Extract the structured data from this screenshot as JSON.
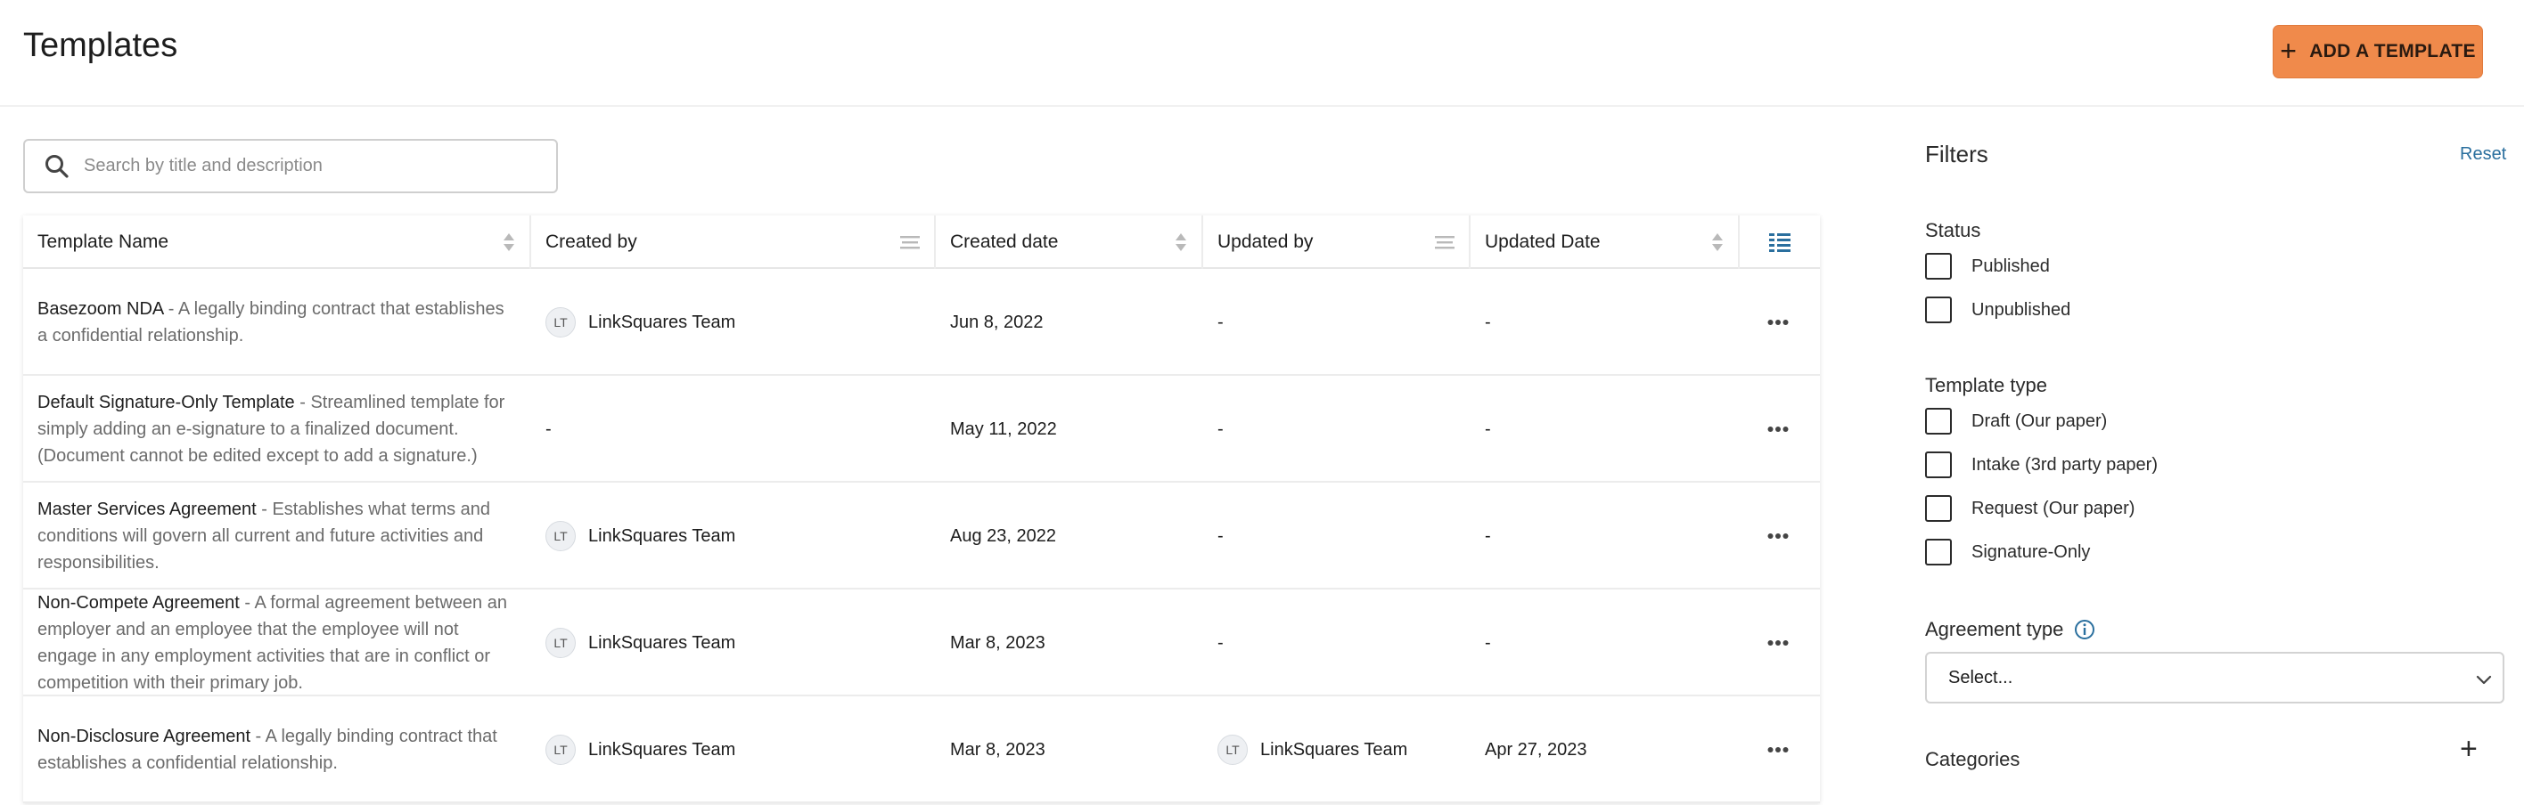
{
  "header": {
    "title": "Templates",
    "add_button_label": "ADD A TEMPLATE"
  },
  "search": {
    "placeholder": "Search by title and description",
    "value": ""
  },
  "table": {
    "columns": [
      "Template Name",
      "Created by",
      "Created date",
      "Updated by",
      "Updated Date"
    ],
    "rows": [
      {
        "name": "Basezoom NDA",
        "separator": " - ",
        "description": "A legally binding contract that establishes a confidential relationship.",
        "created_by_initials": "LT",
        "created_by": "LinkSquares Team",
        "created_date": "Jun 8, 2022",
        "updated_by_initials": "",
        "updated_by": "-",
        "updated_date": "-"
      },
      {
        "name": "Default Signature-Only Template",
        "separator": " - ",
        "description": "Streamlined template for simply adding an e-signature to a finalized document. (Document cannot be edited except to add a signature.)",
        "created_by_initials": "",
        "created_by": "-",
        "created_date": "May 11, 2022",
        "updated_by_initials": "",
        "updated_by": "-",
        "updated_date": "-"
      },
      {
        "name": "Master Services Agreement",
        "separator": " - ",
        "description": "Establishes what terms and conditions will govern all current and future activities and responsibilities.",
        "created_by_initials": "LT",
        "created_by": "LinkSquares Team",
        "created_date": "Aug 23, 2022",
        "updated_by_initials": "",
        "updated_by": "-",
        "updated_date": "-"
      },
      {
        "name": "Non-Compete Agreement",
        "separator": " - ",
        "description": "A formal agreement between an employer and an employee that the employee will not engage in any employment activities that are in conflict or competition with their primary job.",
        "created_by_initials": "LT",
        "created_by": "LinkSquares Team",
        "created_date": "Mar 8, 2023",
        "updated_by_initials": "",
        "updated_by": "-",
        "updated_date": "-"
      },
      {
        "name": "Non-Disclosure Agreement",
        "separator": " - ",
        "description": "A legally binding contract that establishes a confidential relationship.",
        "created_by_initials": "LT",
        "created_by": "LinkSquares Team",
        "created_date": "Mar 8, 2023",
        "updated_by_initials": "LT",
        "updated_by": "LinkSquares Team",
        "updated_date": "Apr 27, 2023"
      }
    ]
  },
  "filters": {
    "title": "Filters",
    "reset_label": "Reset",
    "status": {
      "label": "Status",
      "options": [
        "Published",
        "Unpublished"
      ]
    },
    "template_type": {
      "label": "Template type",
      "options": [
        "Draft (Our paper)",
        "Intake (3rd party paper)",
        "Request (Our paper)",
        "Signature-Only"
      ]
    },
    "agreement_type": {
      "label": "Agreement type",
      "selected": "Select..."
    },
    "categories": {
      "label": "Categories"
    }
  },
  "colors": {
    "accent": "#f08a4b",
    "link": "#2a6f9e",
    "border": "#cfcfcf"
  },
  "icons": {
    "search": "search-icon",
    "sort": "sort-icon",
    "column_menu": "column-menu-icon",
    "column_chooser": "column-chooser-icon",
    "more": "more-horizontal-icon",
    "info": "info-icon",
    "chevron": "chevron-down-icon",
    "plus": "plus-icon"
  }
}
